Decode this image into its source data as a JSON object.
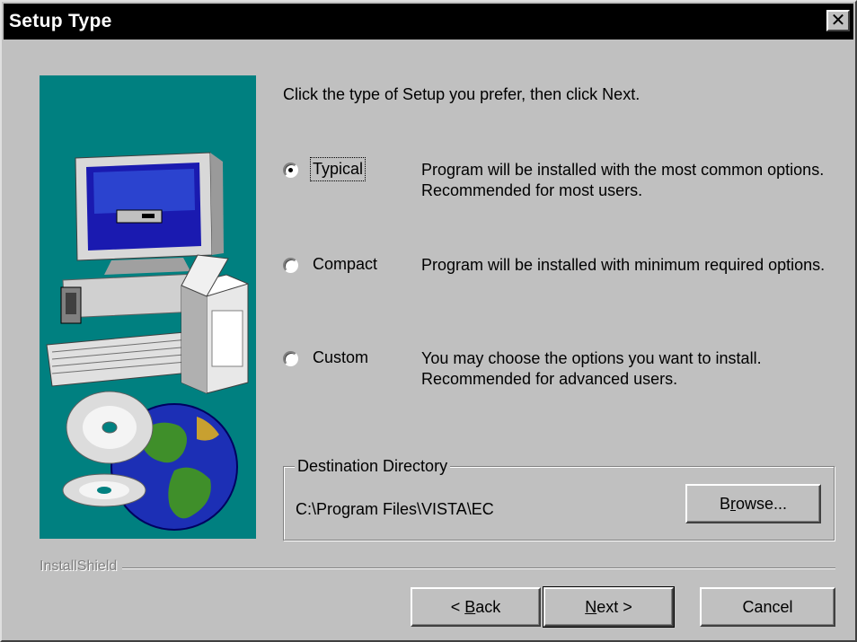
{
  "window": {
    "title": "Setup Type",
    "close_glyph": "✕"
  },
  "prompt": "Click the type of Setup you prefer, then click Next.",
  "options": [
    {
      "label": "Typical",
      "description": "Program will be installed with the most common options. Recommended for most users.",
      "selected": true
    },
    {
      "label": "Compact",
      "description": "Program will be installed with minimum required options.",
      "selected": false
    },
    {
      "label": "Custom",
      "description": "You may choose the options you want to install. Recommended for advanced users.",
      "selected": false
    }
  ],
  "destination": {
    "legend": "Destination Directory",
    "path": "C:\\Program Files\\VISTA\\EC",
    "browse_prefix": "B",
    "browse_accel": "r",
    "browse_suffix": "owse..."
  },
  "branding": "InstallShield",
  "buttons": {
    "back_prefix": "< ",
    "back_accel": "B",
    "back_suffix": "ack",
    "next_accel": "N",
    "next_suffix": "ext >",
    "cancel": "Cancel"
  },
  "colors": {
    "art_background": "#008080",
    "dialog_face": "#c0c0c0",
    "title_bar": "#000000"
  }
}
